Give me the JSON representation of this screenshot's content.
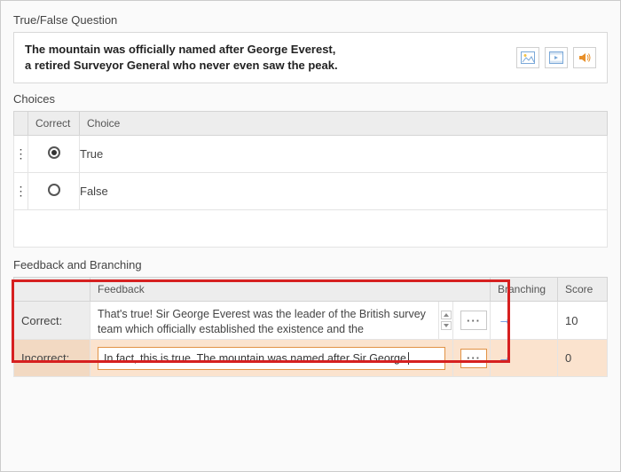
{
  "question_section": {
    "title": "True/False Question",
    "text_line1": "The mountain was officially named after George Everest,",
    "text_line2": "a retired Surveyor General who never even saw the peak."
  },
  "choices_section": {
    "title": "Choices",
    "headers": {
      "correct": "Correct",
      "choice": "Choice"
    },
    "rows": [
      {
        "label": "True",
        "checked": true
      },
      {
        "label": "False",
        "checked": false
      }
    ]
  },
  "feedback_section": {
    "title": "Feedback and Branching",
    "headers": {
      "feedback": "Feedback",
      "branching": "Branching",
      "score": "Score"
    },
    "rows": {
      "correct": {
        "label": "Correct:",
        "text": "That's true! Sir George Everest was the leader of the British survey team which officially established the existence and the",
        "score": "10"
      },
      "incorrect": {
        "label": "Incorrect:",
        "text": "In fact, this is true. The mountain was named after Sir George",
        "score": "0"
      }
    },
    "dots": "···"
  }
}
